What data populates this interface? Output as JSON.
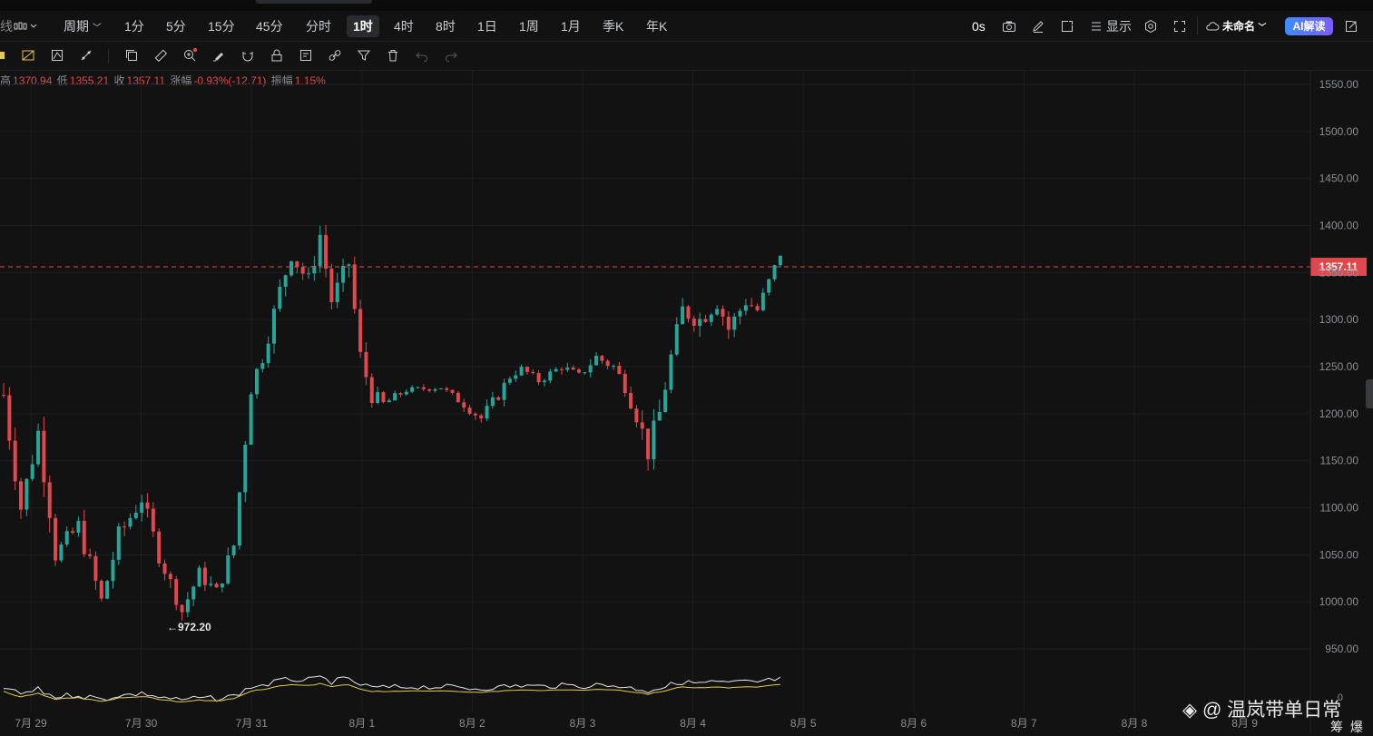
{
  "toolbar": {
    "left_cut": "线",
    "period_label": "周期",
    "intervals": [
      "1分",
      "5分",
      "15分",
      "45分",
      "分时",
      "1时",
      "4时",
      "8时",
      "1日",
      "1周",
      "1月",
      "季K",
      "年K"
    ],
    "active_interval": "1时",
    "timer": "0s",
    "display_label": "显示",
    "layout_name": "未命名",
    "ai_label": "AI解读"
  },
  "ohlc": {
    "high_label": "高",
    "high": "1370.94",
    "low_label": "低",
    "low": "1355.21",
    "close_label": "收",
    "close": "1357.11",
    "change_label": "涨幅",
    "change": "-0.93%(-12.71)",
    "amp_label": "振幅",
    "amp": "1.15%"
  },
  "chart_data": {
    "type": "candlestick",
    "y_axis_ticks": [
      "1550.00",
      "1500.00",
      "1450.00",
      "1400.00",
      "1350.00",
      "1300.00",
      "1250.00",
      "1200.00",
      "1150.00",
      "1100.00",
      "1050.00",
      "1000.00",
      "950.00"
    ],
    "x_axis_ticks": [
      "7月 29",
      "7月 30",
      "7月 31",
      "8月 1",
      "8月 2",
      "8月 3",
      "8月 4",
      "8月 5",
      "8月 6",
      "8月 7",
      "8月 8",
      "8月 9"
    ],
    "last_price": "1357.11",
    "low_marker": "972.20",
    "volume_axis_label": "0",
    "ylim": [
      930,
      1560
    ],
    "grid": true,
    "colors": {
      "up": "#26a69a",
      "down": "#e0484e",
      "last_price": "#e0484e"
    },
    "segments": [
      [
        0,
        1220,
        25
      ],
      [
        3,
        1100,
        14
      ],
      [
        6,
        1180,
        18
      ],
      [
        8,
        1100,
        18
      ],
      [
        9,
        1050,
        12
      ],
      [
        13,
        1080,
        14
      ],
      [
        17,
        1000,
        14
      ],
      [
        20,
        1070,
        14
      ],
      [
        24,
        1110,
        12
      ],
      [
        27,
        1050,
        12
      ],
      [
        31,
        990,
        10
      ],
      [
        34,
        1030,
        10
      ],
      [
        37,
        1010,
        10
      ],
      [
        40,
        1060,
        12
      ],
      [
        43,
        1230,
        16
      ],
      [
        45,
        1260,
        10
      ],
      [
        48,
        1330,
        14
      ],
      [
        50,
        1370,
        12
      ],
      [
        53,
        1340,
        14
      ],
      [
        55,
        1390,
        12
      ],
      [
        57,
        1320,
        12
      ],
      [
        60,
        1360,
        14
      ],
      [
        62,
        1260,
        14
      ],
      [
        64,
        1220,
        12
      ],
      [
        66,
        1210,
        8
      ],
      [
        70,
        1225,
        4
      ],
      [
        76,
        1228,
        4
      ],
      [
        80,
        1210,
        6
      ],
      [
        83,
        1195,
        8
      ],
      [
        86,
        1220,
        8
      ],
      [
        88,
        1240,
        8
      ],
      [
        90,
        1248,
        4
      ],
      [
        93,
        1235,
        6
      ],
      [
        97,
        1250,
        6
      ],
      [
        100,
        1240,
        6
      ],
      [
        103,
        1260,
        8
      ],
      [
        106,
        1250,
        8
      ],
      [
        108,
        1230,
        10
      ],
      [
        110,
        1200,
        14
      ],
      [
        112,
        1160,
        16
      ],
      [
        114,
        1200,
        16
      ],
      [
        116,
        1260,
        14
      ],
      [
        118,
        1310,
        14
      ],
      [
        121,
        1300,
        14
      ],
      [
        124,
        1320,
        14
      ],
      [
        126,
        1290,
        12
      ],
      [
        129,
        1320,
        12
      ],
      [
        131,
        1310,
        8
      ],
      [
        133,
        1340,
        8
      ],
      [
        135,
        1370,
        6
      ]
    ],
    "candle_count": 136,
    "volume_line_color": "#e8e8e8",
    "ma_line_color": "#e6c84a"
  },
  "watermark": {
    "text": "@ 温岚带单日常",
    "sub": "筹 爆"
  }
}
